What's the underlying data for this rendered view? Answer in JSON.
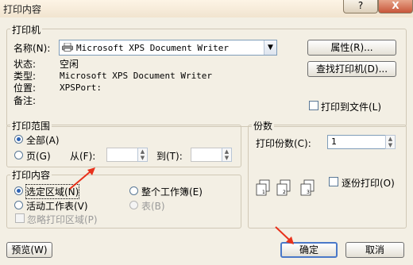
{
  "window": {
    "title": "打印内容",
    "help_button": "?",
    "close_button": "X"
  },
  "printer": {
    "group_label": "打印机",
    "name_label": "名称(N):",
    "name_value": "Microsoft XPS Document Writer",
    "status_label": "状态:",
    "status_value": "空闲",
    "type_label": "类型:",
    "type_value": "Microsoft XPS Document Writer",
    "where_label": "位置:",
    "where_value": "XPSPort:",
    "comment_label": "备注:",
    "comment_value": "",
    "properties_button": "属性(R)...",
    "find_button": "查找打印机(D)...",
    "print_to_file_label": "打印到文件(L)"
  },
  "range": {
    "group_label": "打印范围",
    "all_label": "全部(A)",
    "pages_label": "页(G)",
    "from_label": "从(F):",
    "to_label": "到(T):",
    "from_value": "",
    "to_value": ""
  },
  "copies": {
    "group_label": "份数",
    "count_label": "打印份数(C):",
    "count_value": "1",
    "collate_label": "逐份打印(O)"
  },
  "content": {
    "group_label": "打印内容",
    "selection_label": "选定区域(N)",
    "entire_workbook_label": "整个工作簿(E)",
    "active_sheets_label": "活动工作表(V)",
    "table_label": "表(B)",
    "ignore_print_area_label": "忽略打印区域(P)"
  },
  "footer": {
    "preview_button": "预览(W)",
    "ok_button": "确定",
    "cancel_button": "取消"
  },
  "colors": {
    "annotation_arrow": "#e8321c",
    "radio_selected": "#2e63b4"
  }
}
